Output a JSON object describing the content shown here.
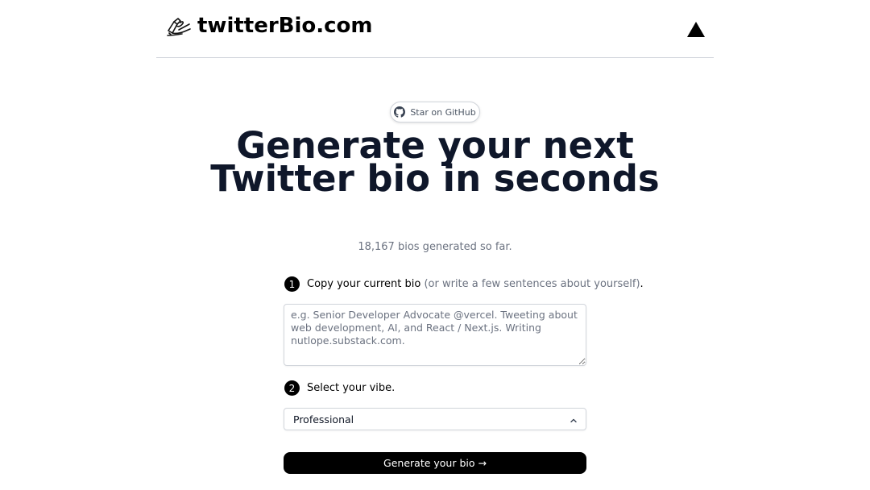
{
  "header": {
    "brand_title": "twitterBio.com",
    "brand_icon": "hand-writing-icon",
    "right_icon": "vercel-triangle-icon"
  },
  "github": {
    "label": "Star on GitHub",
    "icon": "github-icon"
  },
  "hero": {
    "title": "Generate your next Twitter bio in seconds",
    "counter": "18,167 bios generated so far."
  },
  "step1": {
    "number": "1",
    "label": "Copy your current bio",
    "muted": " (or write a few sentences about yourself)",
    "suffix": "."
  },
  "bio_input": {
    "value": "",
    "placeholder": "e.g. Senior Developer Advocate @vercel. Tweeting about web development, AI, and React / Next.js. Writing nutlope.substack.com."
  },
  "step2": {
    "number": "2",
    "label": "Select your vibe."
  },
  "vibe_select": {
    "selected": "Professional",
    "icon": "chevron-up-icon"
  },
  "generate_button": {
    "label": "Generate your bio →"
  },
  "colors": {
    "primary": "#000000",
    "text_dark": "#0f172a",
    "text_muted": "#6b7280",
    "border": "#d1d5db"
  }
}
